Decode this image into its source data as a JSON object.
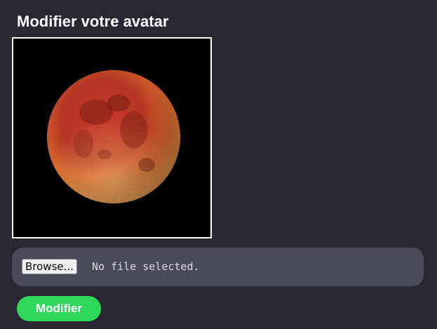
{
  "form": {
    "title": "Modifier votre avatar",
    "avatar_alt": "Lune de sang",
    "file_input": {
      "button_label": "Browse...",
      "status": "No file selected."
    },
    "submit_label": "Modifier"
  },
  "colors": {
    "background": "#282733",
    "file_row": "#4b4a5b",
    "submit": "#2fd75a"
  }
}
